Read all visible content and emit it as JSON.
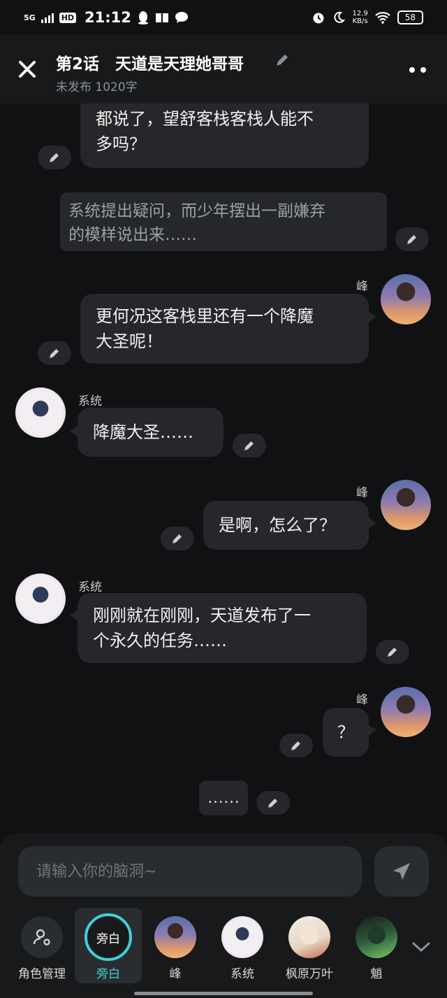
{
  "status_bar": {
    "network": "5G",
    "hd": "HD",
    "time": "21:12",
    "speed_value": "12.9",
    "speed_unit": "KB/s",
    "battery": "58"
  },
  "header": {
    "title": "第2话　天道是天理她哥哥",
    "subtitle": "未发布 1020字"
  },
  "chat": {
    "msg1_line1": "都说了，望舒客栈客栈人能不",
    "msg1_line2": "多吗？",
    "narration_line1": "系统提出疑问，而少年摆出一副嫌弃",
    "narration_line2": "的模样说出来……",
    "feng_name": "峰",
    "system_name": "系统",
    "msg2_line1": "更何况这客栈里还有一个降魔",
    "msg2_line2": "大圣呢！",
    "msg3": "降魔大圣……",
    "msg4": "是啊，怎么了？",
    "msg5_line1": "刚刚就在刚刚，天道发布了一",
    "msg5_line2": "个永久的任务……",
    "msg6": "？",
    "msg7": "……"
  },
  "composer": {
    "placeholder": "请输入你的脑洞~"
  },
  "roles": [
    {
      "label": "角色管理",
      "icon": "role-manage-icon"
    },
    {
      "label": "旁白",
      "badge": "旁白",
      "selected": true
    },
    {
      "label": "峰"
    },
    {
      "label": "系统"
    },
    {
      "label": "枫原万叶"
    },
    {
      "label": "魈"
    }
  ],
  "colors": {
    "accent": "#3fd0dc",
    "background": "#0f1113",
    "bubble": "#25272a"
  }
}
